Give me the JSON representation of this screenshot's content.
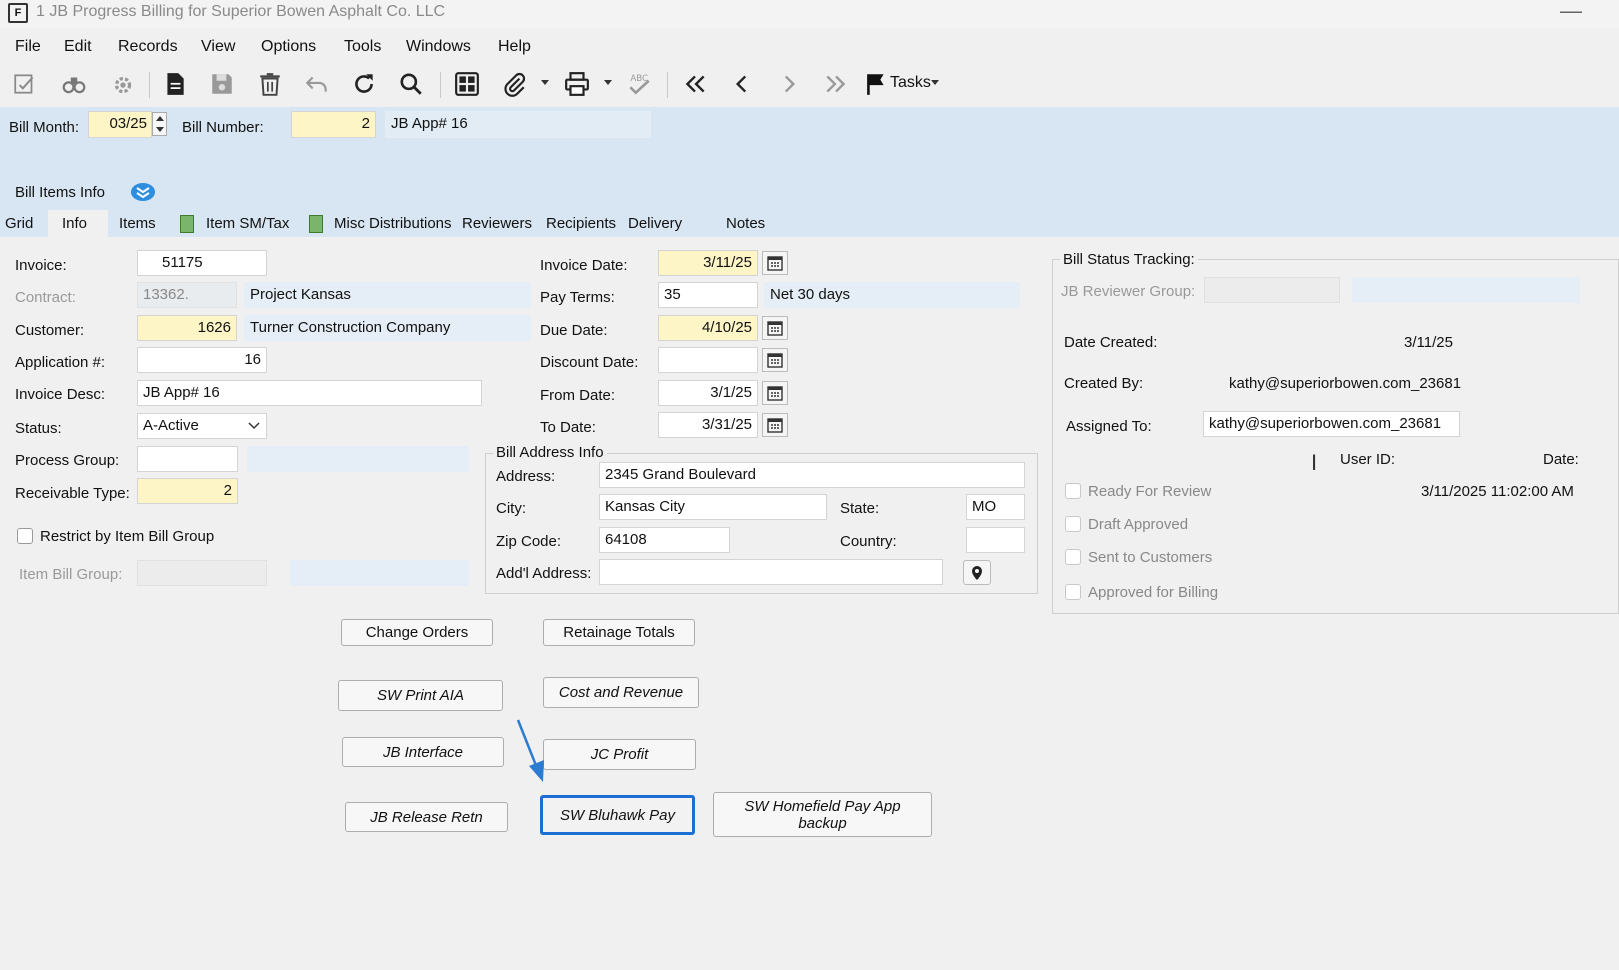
{
  "window": {
    "title": "1 JB Progress Billing for Superior Bowen  Asphalt Co. LLC",
    "app_icon_text": "F"
  },
  "menu": [
    "File",
    "Edit",
    "Records",
    "View",
    "Options",
    "Tools",
    "Windows",
    "Help"
  ],
  "toolbar": {
    "tasks_label": "Tasks"
  },
  "header": {
    "bill_month_label": "Bill Month:",
    "bill_month": "03/25",
    "bill_number_label": "Bill Number:",
    "bill_number": "2",
    "bill_desc": "JB App# 16",
    "bill_items_info": "Bill Items Info"
  },
  "tabs": [
    "Grid",
    "Info",
    "Items",
    "Item SM/Tax",
    "Misc Distributions",
    "Reviewers",
    "Recipients",
    "Delivery",
    "Notes"
  ],
  "info": {
    "invoice_label": "Invoice:",
    "invoice": "51175",
    "contract_label": "Contract:",
    "contract": "13362.",
    "contract_desc": "Project Kansas",
    "customer_label": "Customer:",
    "customer": "1626",
    "customer_name": "Turner Construction Company",
    "application_label": "Application #:",
    "application": "16",
    "invoice_desc_label": "Invoice Desc:",
    "invoice_desc": "JB App# 16",
    "status_label": "Status:",
    "status": "A-Active",
    "process_group_label": "Process Group:",
    "process_group": "",
    "receivable_type_label": "Receivable Type:",
    "receivable_type": "2",
    "restrict_label": "Restrict by Item Bill Group",
    "item_bill_group_label": "Item Bill Group:",
    "invoice_date_label": "Invoice Date:",
    "invoice_date": "3/11/25",
    "pay_terms_label": "Pay Terms:",
    "pay_terms": "35",
    "pay_terms_desc": "Net 30 days",
    "due_date_label": "Due Date:",
    "due_date": "4/10/25",
    "discount_date_label": "Discount Date:",
    "discount_date": "",
    "from_date_label": "From Date:",
    "from_date": "3/1/25",
    "to_date_label": "To Date:",
    "to_date": "3/31/25"
  },
  "address": {
    "group_label": "Bill Address Info",
    "address_label": "Address:",
    "address": "2345 Grand Boulevard",
    "city_label": "City:",
    "city": "Kansas City",
    "state_label": "State:",
    "state": "MO",
    "zip_label": "Zip Code:",
    "zip": "64108",
    "country_label": "Country:",
    "country": "",
    "addl_label": "Add'l Address:",
    "addl": ""
  },
  "tracking": {
    "group_label": "Bill Status Tracking:",
    "reviewer_group_label": "JB Reviewer Group:",
    "date_created_label": "Date Created:",
    "date_created": "3/11/25",
    "created_by_label": "Created By:",
    "created_by": "kathy@superiorbowen.com_23681",
    "assigned_to_label": "Assigned To:",
    "assigned_to": "kathy@superiorbowen.com_23681",
    "user_id_label": "User ID:",
    "date_label": "Date:",
    "ready_label": "Ready For Review",
    "ready_date": "3/11/2025 11:02:00 AM",
    "draft_label": "Draft Approved",
    "sent_label": "Sent to Customers",
    "approved_label": "Approved for Billing"
  },
  "buttons": {
    "change_orders": "Change Orders",
    "retainage_totals": "Retainage Totals",
    "sw_print_aia": "SW Print AIA",
    "cost_and_revenue": "Cost and Revenue",
    "jb_interface": "JB Interface",
    "jc_profit": "JC Profit",
    "jb_release_retn": "JB Release Retn",
    "sw_bluhawk_pay": "SW Bluhawk Pay",
    "sw_homefield_line1": "SW Homefield Pay App",
    "sw_homefield_line2": "backup"
  },
  "colors": {
    "header_band": "#d7e6f2",
    "required_field": "#fdf5c6",
    "focus": "#1c6fd4",
    "arrow": "#2a7bd1"
  }
}
